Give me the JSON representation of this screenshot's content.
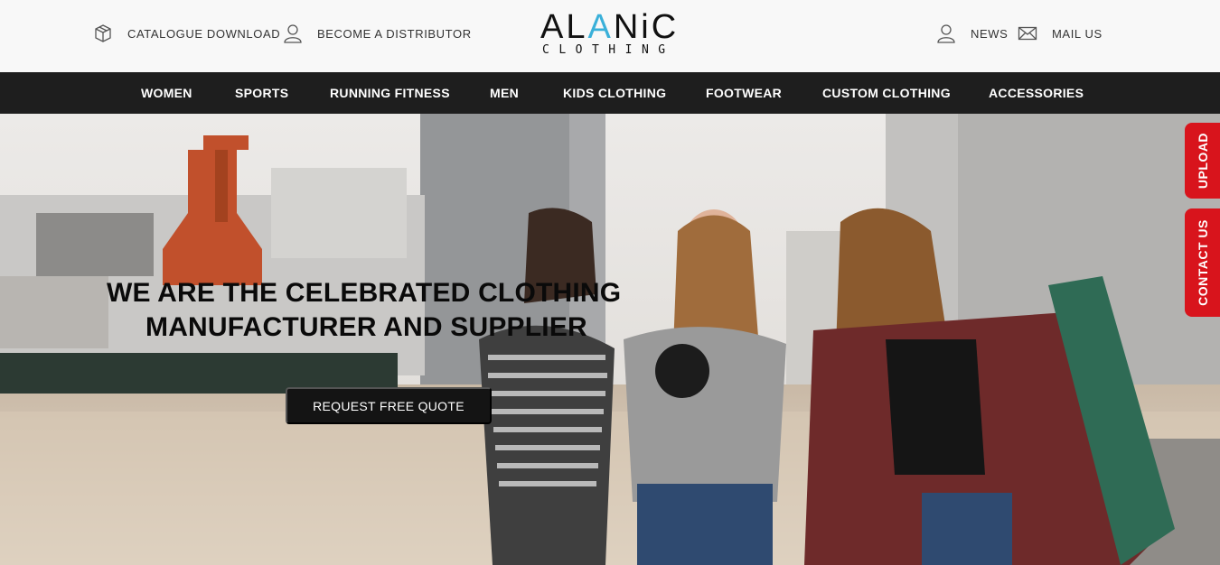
{
  "header": {
    "utility_left": [
      {
        "label": "CATALOGUE DOWNLOAD",
        "icon": "box-icon"
      },
      {
        "label": "BECOME A DISTRIBUTOR",
        "icon": "user-icon"
      }
    ],
    "utility_right": [
      {
        "label": "NEWS",
        "icon": "user-icon"
      },
      {
        "label": "MAIL US",
        "icon": "envelope-icon"
      }
    ],
    "logo": {
      "main_pre": "AL",
      "main_accent": "A",
      "main_post": "NiC",
      "sub": "CLOTHING",
      "accent_color": "#3ab0d9"
    }
  },
  "nav": {
    "items": [
      {
        "label": "WOMEN"
      },
      {
        "label": "SPORTS"
      },
      {
        "label": "RUNNING FITNESS"
      },
      {
        "label": "MEN"
      },
      {
        "label": "KIDS CLOTHING"
      },
      {
        "label": "FOOTWEAR"
      },
      {
        "label": "CUSTOM CLOTHING"
      },
      {
        "label": "ACCESSORIES"
      }
    ]
  },
  "hero": {
    "title_line1": "WE ARE THE CELEBRATED CLOTHING",
    "title_line2": "MANUFACTURER AND SUPPLIER",
    "cta_label": "REQUEST FREE QUOTE"
  },
  "side_tabs": {
    "upload_label": "UPLOAD",
    "contact_label": "CONTACT US",
    "color": "#d8141c"
  },
  "colors": {
    "nav_bg": "#1e1e1e",
    "topbar_bg": "#f8f8f8",
    "cta_bg": "#141414"
  }
}
